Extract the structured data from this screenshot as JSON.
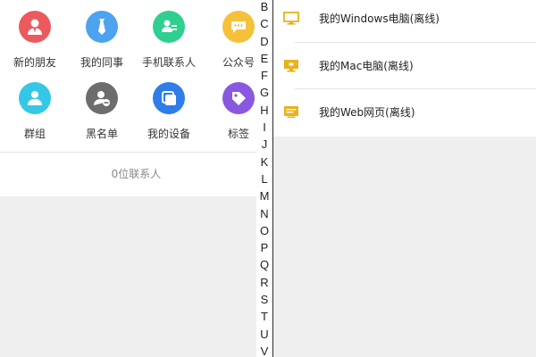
{
  "grid": {
    "tiles": [
      {
        "label": "新的朋友",
        "icon": "person-icon",
        "color": "#ec5a5e"
      },
      {
        "label": "我的同事",
        "icon": "tie-icon",
        "color": "#4da3f0"
      },
      {
        "label": "手机联系人",
        "icon": "contact-card-icon",
        "color": "#2fcf8f"
      },
      {
        "label": "公众号",
        "icon": "chat-bubble-icon",
        "color": "#f5c13b"
      },
      {
        "label": "群组",
        "icon": "group-icon",
        "color": "#35c8e6"
      },
      {
        "label": "黑名单",
        "icon": "blocked-user-icon",
        "color": "#6d6d6d"
      },
      {
        "label": "我的设备",
        "icon": "devices-icon",
        "color": "#2f7de8"
      },
      {
        "label": "标签",
        "icon": "tag-icon",
        "color": "#8a58e0"
      }
    ]
  },
  "contacts": {
    "count_text": "0位联系人"
  },
  "index_bar": {
    "letters": [
      "B",
      "C",
      "D",
      "E",
      "F",
      "G",
      "H",
      "I",
      "J",
      "K",
      "L",
      "M",
      "N",
      "O",
      "P",
      "Q",
      "R",
      "S",
      "T",
      "U",
      "V"
    ]
  },
  "devices": {
    "icon_color": "#e7b21e",
    "items": [
      {
        "label": "我的Windows电脑(离线)",
        "icon": "monitor-icon"
      },
      {
        "label": "我的Mac电脑(离线)",
        "icon": "monitor-icon"
      },
      {
        "label": "我的Web网页(离线)",
        "icon": "browser-icon"
      }
    ]
  }
}
